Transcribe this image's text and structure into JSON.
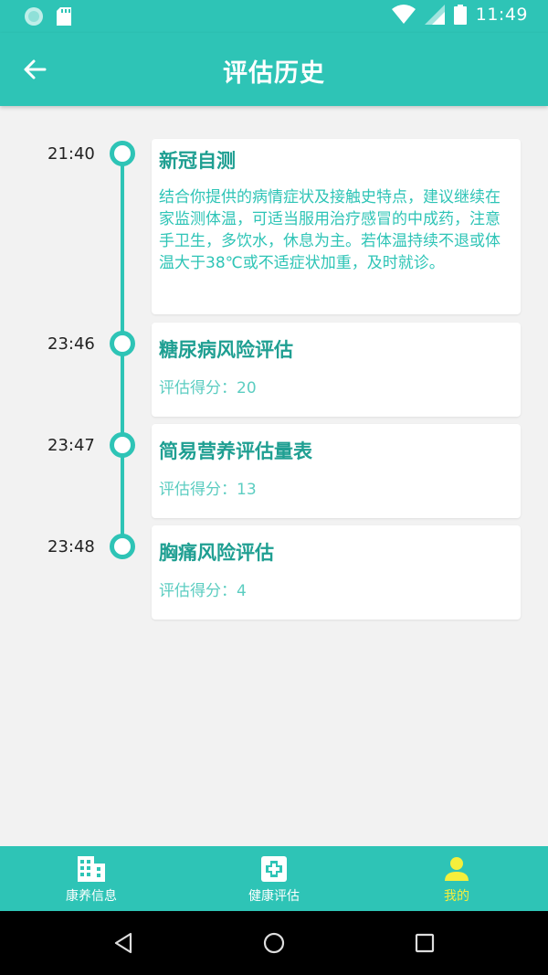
{
  "status_bar": {
    "time": "11:49"
  },
  "app_bar": {
    "title": "评估历史"
  },
  "entries": [
    {
      "time": "21:40",
      "title": "新冠自测",
      "body": "结合你提供的病情症状及接触史特点，建议继续在家监测体温，可适当服用治疗感冒的中成药，注意手卫生，多饮水，休息为主。若体温持续不退或体温大于38℃或不适症状加重，及时就诊。"
    },
    {
      "time": "23:46",
      "title": "糖尿病风险评估",
      "score": "评估得分：20"
    },
    {
      "time": "23:47",
      "title": "简易营养评估量表",
      "score": "评估得分：13"
    },
    {
      "time": "23:48",
      "title": "胸痛风险评估",
      "score": "评估得分：4"
    }
  ],
  "bottom_nav": [
    {
      "label": "康养信息",
      "icon": "building-icon"
    },
    {
      "label": "健康评估",
      "icon": "medical-cross-icon"
    },
    {
      "label": "我的",
      "icon": "person-icon",
      "active": true
    }
  ],
  "colors": {
    "primary": "#2ec4b6",
    "title_text": "#1f9f92",
    "active_nav": "#f5ef3c"
  }
}
